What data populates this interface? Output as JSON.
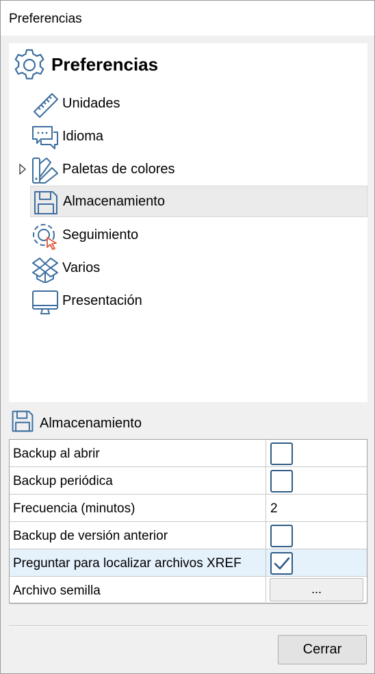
{
  "window": {
    "title": "Preferencias"
  },
  "tree": {
    "root_label": "Preferencias",
    "items": [
      {
        "label": "Unidades",
        "icon": "ruler-icon"
      },
      {
        "label": "Idioma",
        "icon": "speech-bubbles-icon"
      },
      {
        "label": "Paletas de colores",
        "icon": "color-palette-icon",
        "expandable": true
      },
      {
        "label": "Almacenamiento",
        "icon": "floppy-disk-icon",
        "selected": true
      },
      {
        "label": "Seguimiento",
        "icon": "snap-target-icon"
      },
      {
        "label": "Varios",
        "icon": "dropbox-icon"
      },
      {
        "label": "Presentación",
        "icon": "monitor-icon"
      }
    ]
  },
  "section": {
    "title": "Almacenamiento",
    "icon": "floppy-disk-icon"
  },
  "properties": [
    {
      "name": "Backup al abrir",
      "type": "checkbox",
      "checked": false
    },
    {
      "name": "Backup periódica",
      "type": "checkbox",
      "checked": false
    },
    {
      "name": "Frecuencia (minutos)",
      "type": "number",
      "value": "2"
    },
    {
      "name": "Backup de versión anterior",
      "type": "checkbox",
      "checked": false
    },
    {
      "name": "Preguntar para localizar archivos XREF",
      "type": "checkbox",
      "checked": true
    },
    {
      "name": "Archivo semilla",
      "type": "button",
      "value": "..."
    }
  ],
  "footer": {
    "close_label": "Cerrar"
  },
  "colors": {
    "icon_blue": "#3c6e9f",
    "icon_red": "#e0553b",
    "selection_bg": "#ebebeb",
    "row_highlight": "#e5f1fb"
  }
}
